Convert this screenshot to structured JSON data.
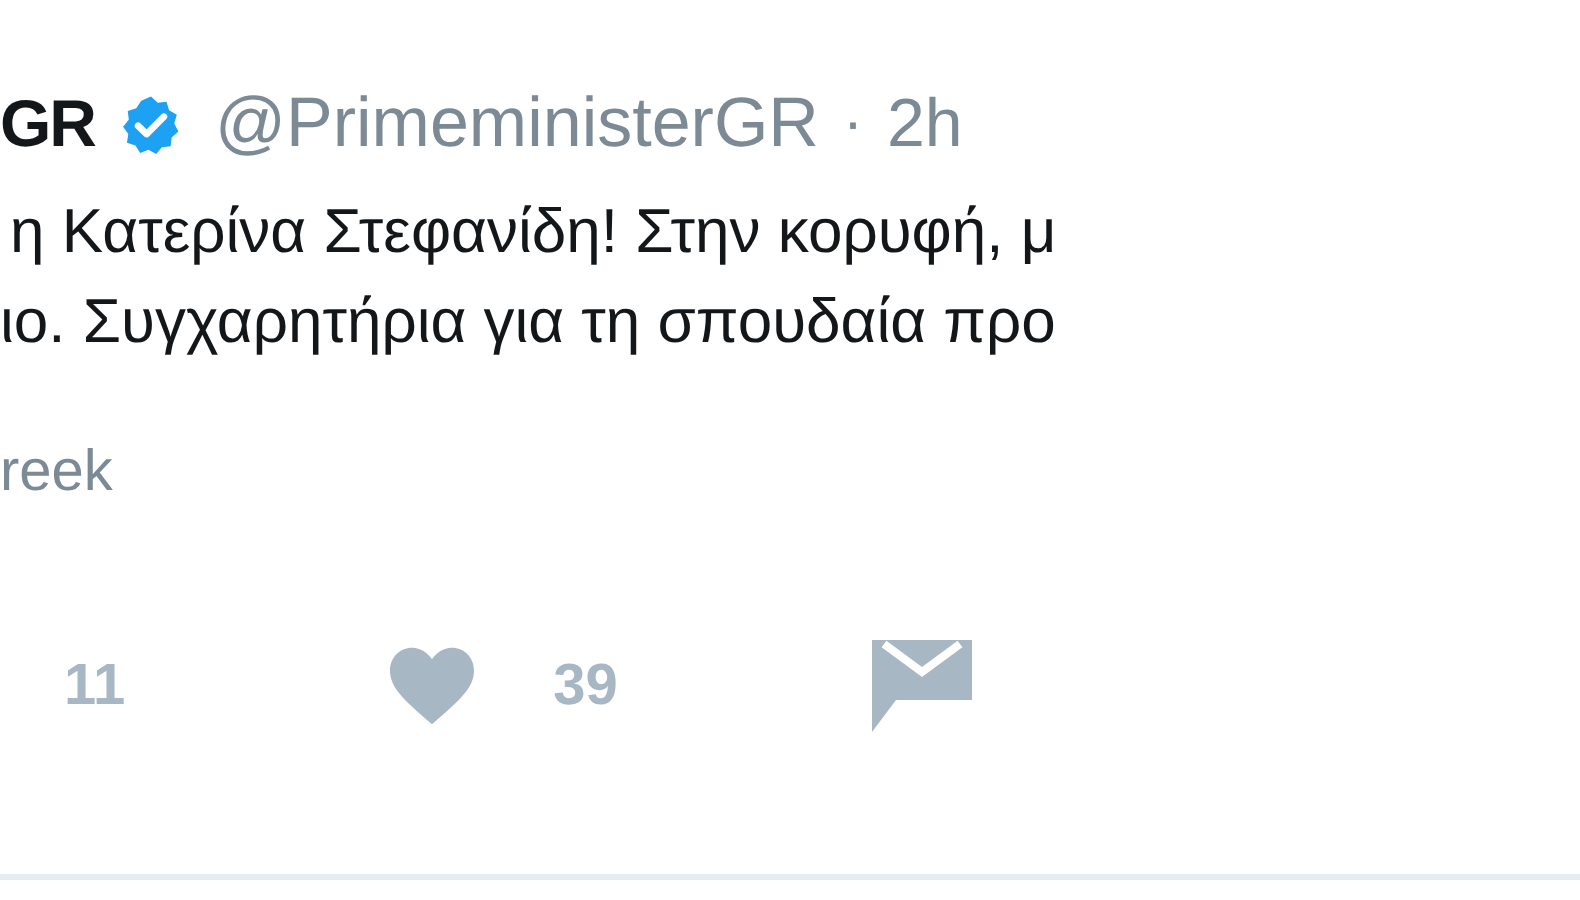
{
  "tweet": {
    "name": "GR",
    "verified": true,
    "handle": "@PrimeministerGR",
    "separator": "·",
    "time": "2h",
    "lines": [
      "η Κατερίνα Στεφανίδη! Στην κορυφή, μ",
      "ιο. Συγχαρητήρια για τη σπουδαία προ"
    ],
    "translate": "reek",
    "actions": [
      {
        "kind": "retweet",
        "count": "11"
      },
      {
        "kind": "like",
        "count": "39"
      },
      {
        "kind": "message"
      }
    ]
  }
}
